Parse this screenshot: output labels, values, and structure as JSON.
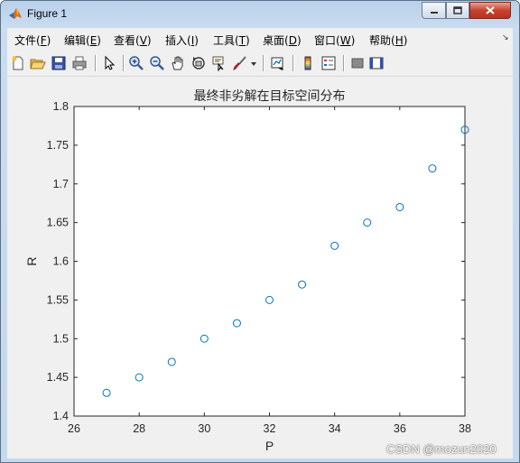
{
  "window": {
    "title": "Figure 1"
  },
  "menu": [
    {
      "label": "文件(",
      "key": "F",
      "close": ")"
    },
    {
      "label": "编辑(",
      "key": "E",
      "close": ")"
    },
    {
      "label": "查看(",
      "key": "V",
      "close": ")"
    },
    {
      "label": "插入(",
      "key": "I",
      "close": ")"
    },
    {
      "label": "工具(",
      "key": "T",
      "close": ")"
    },
    {
      "label": "桌面(",
      "key": "D",
      "close": ")"
    },
    {
      "label": "窗口(",
      "key": "W",
      "close": ")"
    },
    {
      "label": "帮助(",
      "key": "H",
      "close": ")"
    }
  ],
  "toolbar_icons": [
    "new-figure-icon",
    "open-file-icon",
    "save-icon",
    "print-icon",
    "select-arrow-icon",
    "zoom-in-icon",
    "zoom-out-icon",
    "pan-hand-icon",
    "rotate-3d-icon",
    "data-cursor-icon",
    "brush-icon",
    "brush-dropdown-icon",
    "link-plot-icon",
    "colorbar-icon",
    "legend-icon",
    "hide-plot-tools-icon",
    "show-plot-tools-icon"
  ],
  "chart_data": {
    "type": "scatter",
    "title": "最终非劣解在目标空间分布",
    "xlabel": "P",
    "ylabel": "R",
    "xlim": [
      26,
      38
    ],
    "ylim": [
      1.4,
      1.8
    ],
    "xticks": [
      "26",
      "28",
      "30",
      "32",
      "34",
      "36",
      "38"
    ],
    "yticks": [
      "1.4",
      "1.45",
      "1.5",
      "1.55",
      "1.6",
      "1.65",
      "1.7",
      "1.75",
      "1.8"
    ],
    "x": [
      27,
      28,
      29,
      30,
      31,
      32,
      33,
      34,
      35,
      36,
      37,
      38
    ],
    "y": [
      1.43,
      1.45,
      1.47,
      1.5,
      1.52,
      1.55,
      1.57,
      1.62,
      1.65,
      1.67,
      1.72,
      1.77
    ],
    "marker": "circle-open",
    "marker_color": "#0072bd",
    "grid": false
  },
  "watermark": "CSDN @mozun2020"
}
